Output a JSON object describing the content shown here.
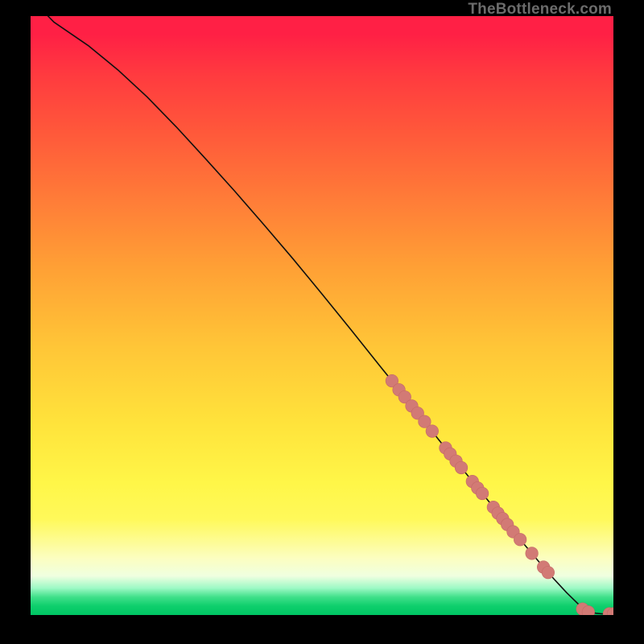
{
  "watermark": "TheBottleneck.com",
  "colors": {
    "curve": "#101010",
    "dot_fill": "#d27a75",
    "dot_stroke": "#c46a65"
  },
  "chart_data": {
    "type": "line",
    "title": "",
    "xlabel": "",
    "ylabel": "",
    "xlim": [
      0,
      100
    ],
    "ylim": [
      0,
      100
    ],
    "grid": false,
    "series": [
      {
        "name": "curve",
        "x": [
          0,
          2,
          4,
          7,
          10,
          15,
          20,
          25,
          30,
          35,
          40,
          45,
          50,
          55,
          60,
          62,
          64,
          66,
          68,
          70,
          72,
          74,
          76,
          78,
          80,
          82,
          84,
          86,
          88,
          90,
          92,
          94,
          95,
          96,
          97,
          98,
          99,
          100
        ],
        "y": [
          102,
          101,
          99,
          97,
          95,
          91,
          86.5,
          81.5,
          76.2,
          70.8,
          65.2,
          59.5,
          53.6,
          47.6,
          41.5,
          39.1,
          36.6,
          34.2,
          31.8,
          29.3,
          26.9,
          24.5,
          22.1,
          19.7,
          17.3,
          14.9,
          12.6,
          10.3,
          8.0,
          5.8,
          3.7,
          1.8,
          1.0,
          0.5,
          0.3,
          0.2,
          0.2,
          0.2
        ]
      }
    ],
    "dots": [
      {
        "x": 62.0,
        "y": 39.1
      },
      {
        "x": 63.2,
        "y": 37.6
      },
      {
        "x": 64.2,
        "y": 36.4
      },
      {
        "x": 65.4,
        "y": 34.9
      },
      {
        "x": 66.4,
        "y": 33.7
      },
      {
        "x": 67.6,
        "y": 32.3
      },
      {
        "x": 68.9,
        "y": 30.7
      },
      {
        "x": 71.2,
        "y": 27.9
      },
      {
        "x": 72.0,
        "y": 26.9
      },
      {
        "x": 73.0,
        "y": 25.7
      },
      {
        "x": 73.9,
        "y": 24.6
      },
      {
        "x": 75.8,
        "y": 22.3
      },
      {
        "x": 76.7,
        "y": 21.2
      },
      {
        "x": 77.5,
        "y": 20.3
      },
      {
        "x": 79.4,
        "y": 18.0
      },
      {
        "x": 80.2,
        "y": 17.0
      },
      {
        "x": 81.0,
        "y": 16.1
      },
      {
        "x": 81.8,
        "y": 15.1
      },
      {
        "x": 82.8,
        "y": 13.9
      },
      {
        "x": 84.0,
        "y": 12.6
      },
      {
        "x": 86.0,
        "y": 10.3
      },
      {
        "x": 88.0,
        "y": 8.0
      },
      {
        "x": 88.8,
        "y": 7.1
      },
      {
        "x": 94.7,
        "y": 1.0
      },
      {
        "x": 95.7,
        "y": 0.5
      },
      {
        "x": 99.3,
        "y": 0.2
      },
      {
        "x": 100.0,
        "y": 0.2
      }
    ]
  }
}
